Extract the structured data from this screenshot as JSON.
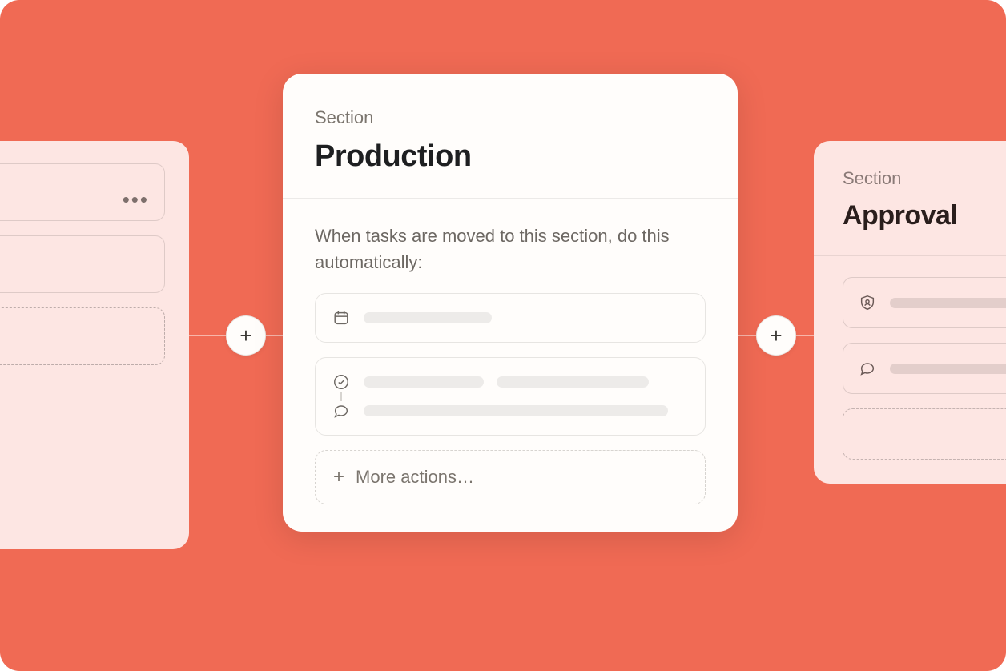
{
  "left_section": {},
  "center_section": {
    "eyebrow": "Section",
    "title": "Production",
    "description": "When tasks are moved to this section, do this automatically:",
    "more_actions_label": "More actions…"
  },
  "right_section": {
    "eyebrow": "Section",
    "title": "Approval"
  }
}
